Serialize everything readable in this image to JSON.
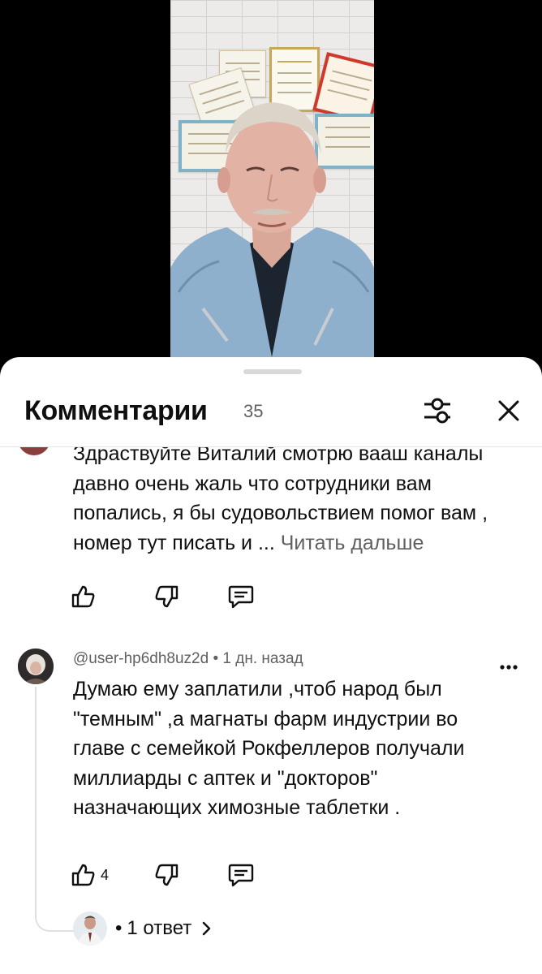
{
  "sheet": {
    "title": "Комментарии",
    "count": "35"
  },
  "header_icons": {
    "filter": "sliders-icon",
    "close": "close-icon"
  },
  "comments": [
    {
      "text": "Здраствуйте Виталий смотрю вааш каналы давно очень жаль что сотрудники вам попались, я бы судовольствием помог вам , номер тут писать и ...",
      "read_more": "Читать дальше",
      "likes": ""
    },
    {
      "author": "@user-hp6dh8uz2d",
      "separator": "•",
      "time": "1 дн. назад",
      "text": "Думаю ему заплатили ,чтоб народ был \"темным\" ,а магнаты фарм индустрии во главе с семейкой Рокфеллеров получали миллиарды с аптек и \"докторов\" назначающих химозные таблетки .",
      "likes": "4",
      "replies_dot": "•",
      "replies_label": "1 ответ"
    }
  ],
  "colors": {
    "text_primary": "#0f0f0f",
    "text_secondary": "#606060",
    "divider": "#e5e5e5",
    "handle": "#d9d9d9"
  }
}
